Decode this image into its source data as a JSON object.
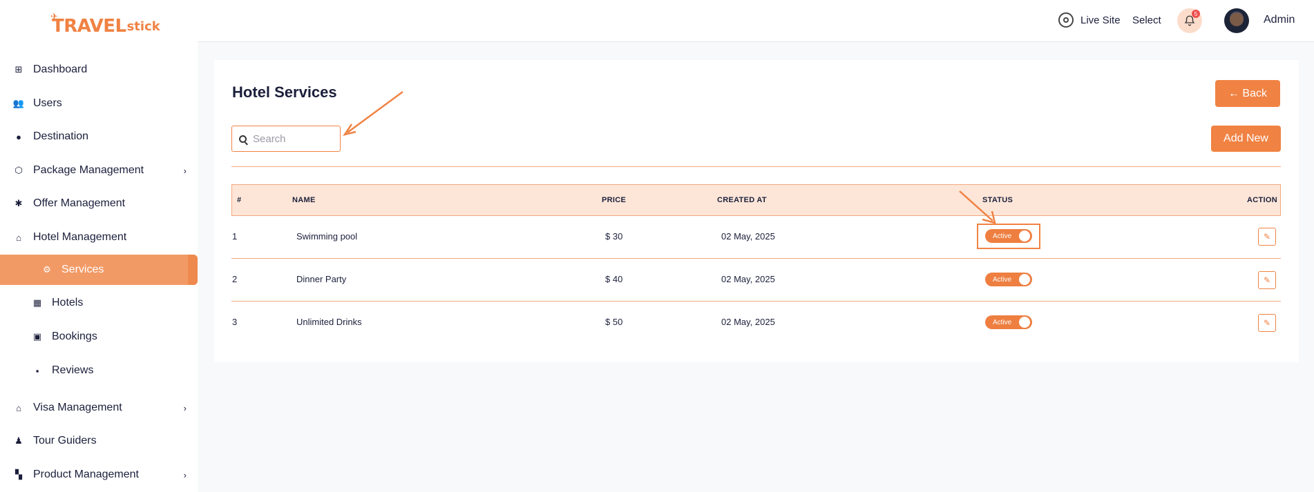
{
  "brand": {
    "logo_main": "TRAVEL",
    "logo_sub": "stick"
  },
  "colors": {
    "accent": "#f08243",
    "accent_light": "#fde6d8",
    "active_nav": "#f29a66",
    "text": "#1b1f3b"
  },
  "sidebar": {
    "items": [
      {
        "label": "Dashboard",
        "icon": "dashboard-icon"
      },
      {
        "label": "Users",
        "icon": "users-icon"
      },
      {
        "label": "Destination",
        "icon": "destination-pin-icon"
      },
      {
        "label": "Package Management",
        "icon": "package-box-icon",
        "has_submenu": true
      },
      {
        "label": "Offer Management",
        "icon": "offer-badge-icon"
      },
      {
        "label": "Hotel Management",
        "icon": "hotel-icon"
      },
      {
        "label": "Services",
        "icon": "services-icon",
        "active": true,
        "sub": true
      },
      {
        "label": "Hotels",
        "icon": "building-icon",
        "sub": true
      },
      {
        "label": "Bookings",
        "icon": "calendar-icon",
        "sub": true
      },
      {
        "label": "Reviews",
        "icon": "chat-bubble-icon",
        "sub": true
      },
      {
        "label": "Visa Management",
        "icon": "visa-icon",
        "has_submenu": true
      },
      {
        "label": "Tour Guiders",
        "icon": "person-icon"
      },
      {
        "label": "Product Management",
        "icon": "grid-icon",
        "has_submenu": true
      }
    ]
  },
  "topbar": {
    "live_site": "Live Site",
    "select": "Select",
    "notifications_count": "5",
    "user_name": "Admin"
  },
  "page": {
    "title": "Hotel Services",
    "back_label": "← Back",
    "add_new_label": "Add New",
    "search_placeholder": "Search"
  },
  "table": {
    "headers": {
      "index": "#",
      "name": "NAME",
      "price": "PRICE",
      "created_at": "CREATED AT",
      "status": "STATUS",
      "action": "ACTION"
    },
    "rows": [
      {
        "index": "1",
        "name": "Swimming pool",
        "price": "$ 30",
        "created_at": "02 May, 2025",
        "status": "Active"
      },
      {
        "index": "2",
        "name": "Dinner Party",
        "price": "$ 40",
        "created_at": "02 May, 2025",
        "status": "Active"
      },
      {
        "index": "3",
        "name": "Unlimited Drinks",
        "price": "$ 50",
        "created_at": "02 May, 2025",
        "status": "Active"
      }
    ]
  }
}
